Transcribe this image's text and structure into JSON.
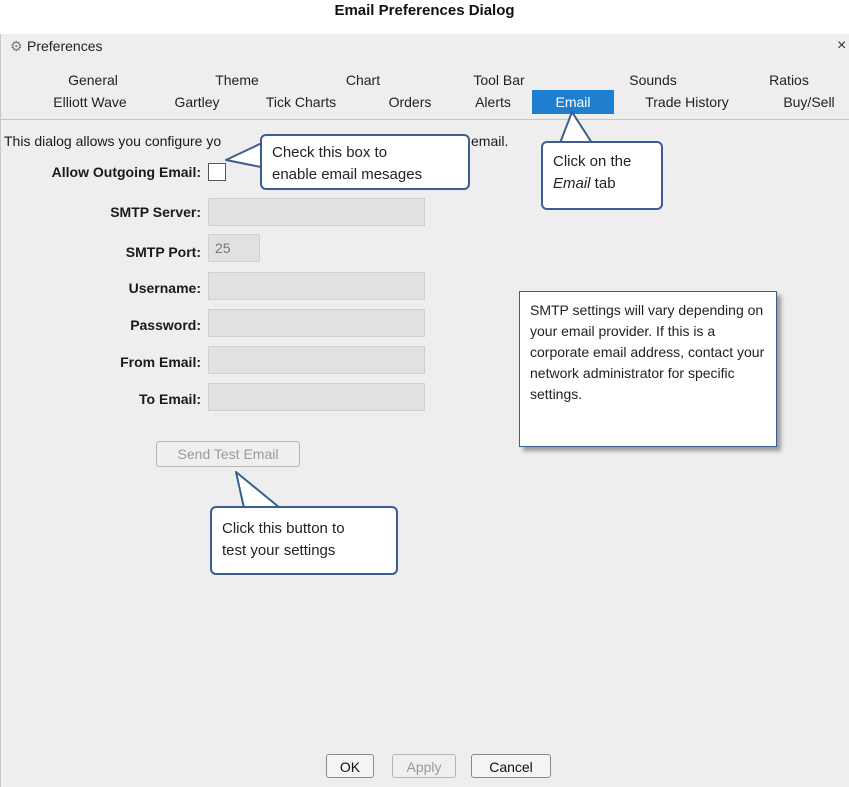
{
  "caption": "Email Preferences Dialog",
  "window": {
    "title": "Preferences",
    "close_symbol": "×"
  },
  "tabs": {
    "row1": [
      "General",
      "Theme",
      "Chart",
      "Tool Bar",
      "Sounds",
      "Ratios"
    ],
    "row2": [
      "Elliott Wave",
      "Gartley",
      "Tick Charts",
      "Orders",
      "Alerts",
      "Email",
      "Trade History",
      "Buy/Sell"
    ],
    "selected": "Email",
    "selected_color": "#1e7fd0"
  },
  "intro_left": "This dialog allows you configure yo",
  "intro_right": "email.",
  "form": {
    "allow_label": "Allow Outgoing Email:",
    "smtp_server_label": "SMTP Server:",
    "smtp_port_label": "SMTP Port:",
    "smtp_port_value": "25",
    "username_label": "Username:",
    "password_label": "Password:",
    "from_label": "From Email:",
    "to_label": "To Email:",
    "test_button": "Send Test Email"
  },
  "callouts": {
    "checkbox_line1": "Check this box to",
    "checkbox_line2": "enable email mesages",
    "tab_line1": "Click on the",
    "tab_line2_italic": "Email",
    "tab_line2_rest": " tab",
    "button_line1": "Click this button to",
    "button_line2": "test your settings",
    "smtp_note": "SMTP settings will vary depending on your email provider.  If this is a corporate email address, contact your network administrator for specific settings.",
    "border_color": "#3b5e8f"
  },
  "footer": {
    "ok": "OK",
    "apply": "Apply",
    "cancel": "Cancel"
  }
}
